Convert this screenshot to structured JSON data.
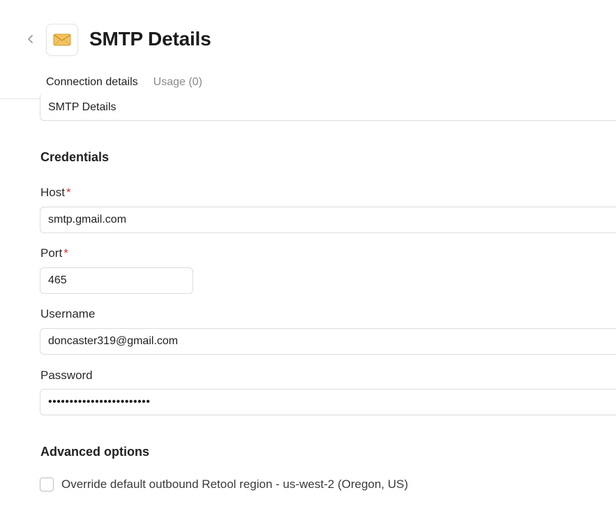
{
  "header": {
    "title": "SMTP Details",
    "back_icon": "chevron-left-icon",
    "app_icon": "envelope-icon"
  },
  "tabs": [
    {
      "label": "Connection details",
      "active": true
    },
    {
      "label": "Usage",
      "count": "(0)",
      "active": false
    }
  ],
  "form": {
    "name_value": "SMTP Details",
    "credentials_title": "Credentials",
    "host": {
      "label": "Host",
      "required": "*",
      "value": "smtp.gmail.com"
    },
    "port": {
      "label": "Port",
      "required": "*",
      "value": "465"
    },
    "username": {
      "label": "Username",
      "value": "doncaster319@gmail.com"
    },
    "password": {
      "label": "Password",
      "value": "••••••••••••••••••••••••"
    },
    "advanced_title": "Advanced options",
    "override_region": {
      "label": "Override default outbound Retool region - us-west-2 (Oregon, US)",
      "checked": false
    }
  },
  "colors": {
    "required": "#d4342c",
    "envelope": "#f0b94a"
  }
}
